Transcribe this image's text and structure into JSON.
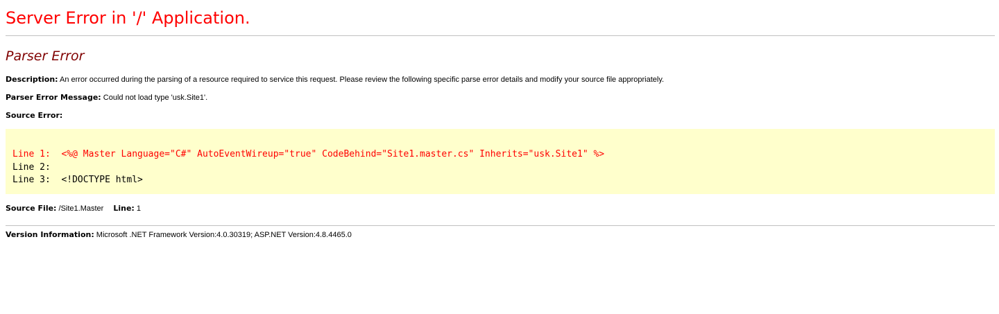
{
  "title": "Server Error in '/' Application.",
  "subtitle": "Parser Error",
  "description": {
    "label": "Description:",
    "text": " An error occurred during the parsing of a resource required to service this request. Please review the following specific parse error details and modify your source file appropriately."
  },
  "parser_error_message": {
    "label": "Parser Error Message:",
    "text": " Could not load type 'usk.Site1'."
  },
  "source_error": {
    "label": "Source Error:",
    "lines": [
      {
        "prefix": "Line 1:  ",
        "code": "<%@ Master Language=\"C#\" AutoEventWireup=\"true\" CodeBehind=\"Site1.master.cs\" Inherits=\"usk.Site1\" %>",
        "is_error": true
      },
      {
        "prefix": "Line 2:  ",
        "code": "",
        "is_error": false
      },
      {
        "prefix": "Line 3:  ",
        "code": "<!DOCTYPE html>",
        "is_error": false
      }
    ]
  },
  "source_file": {
    "label": "Source File:",
    "value": " /Site1.Master",
    "line_label": "Line:",
    "line_value": " 1"
  },
  "version_info": {
    "label": "Version Information:",
    "text": " Microsoft .NET Framework Version:4.0.30319; ASP.NET Version:4.8.4465.0"
  },
  "colors": {
    "title": "#ff0000",
    "subtitle": "#800000",
    "code_background": "#ffffcc",
    "error_line": "#ff0000",
    "rule": "#c0c0c0"
  }
}
